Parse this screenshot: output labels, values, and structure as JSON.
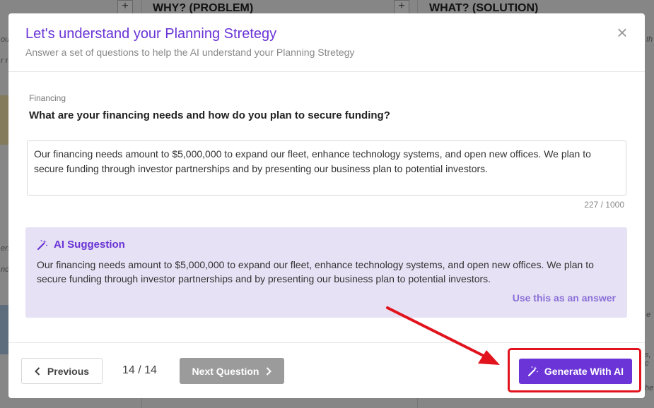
{
  "background": {
    "col1_heading": "WHY? (PROBLEM)",
    "col2_heading": "WHAT? (SOLUTION)",
    "plus_glyph": "+",
    "fragments": [
      "ou",
      "r r",
      "ers",
      "nc",
      "th",
      "e",
      "s, c",
      "he"
    ]
  },
  "modal": {
    "title": "Let's understand your Planning Stretegy",
    "subtitle": "Answer a set of questions to help the AI understand your Planning Stretegy",
    "close_glyph": "×"
  },
  "question": {
    "section": "Financing",
    "text": "What are your financing needs and how do you plan to secure funding?",
    "answer": "Our financing needs amount to $5,000,000 to expand our fleet, enhance technology systems, and open new offices. We plan to secure funding through investor partnerships and by presenting our business plan to potential investors.",
    "counter": "227 / 1000"
  },
  "suggestion": {
    "heading": "AI Suggestion",
    "icon": "magic-wand-icon",
    "text": "Our financing needs amount to $5,000,000 to expand our fleet, enhance technology systems, and open new offices. We plan to secure funding through investor partnerships and by presenting our business plan to potential investors.",
    "use_label": "Use this as an answer"
  },
  "footer": {
    "prev_label": "Previous",
    "page_indicator": "14 / 14",
    "next_label": "Next Question",
    "generate_label": "Generate With AI"
  },
  "colors": {
    "accent": "#6a34d6",
    "suggestion_bg": "#e6e1f4",
    "annotation_red": "#e1141e",
    "disabled_button": "#9b9b9b"
  }
}
